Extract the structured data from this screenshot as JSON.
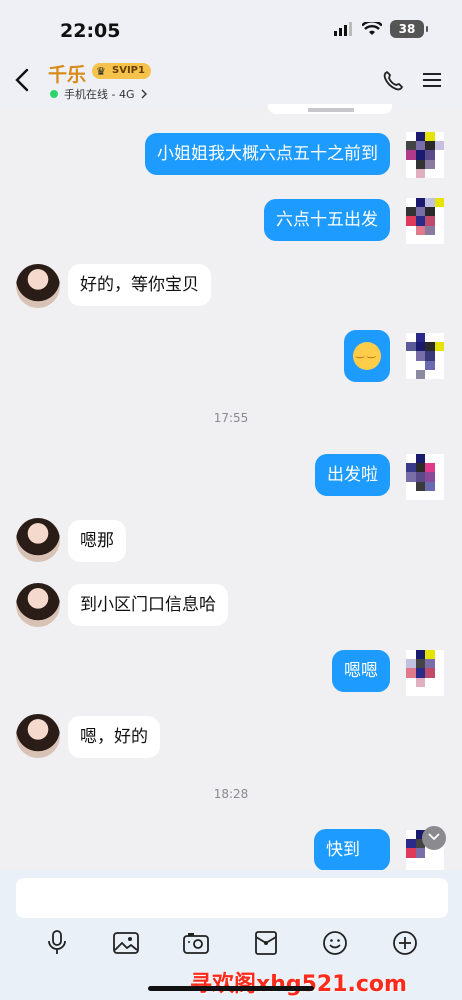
{
  "status_bar": {
    "time": "22:05",
    "battery": "38"
  },
  "header": {
    "contact_name": "千乐",
    "badge": "SVIP1",
    "status": "手机在线 - 4G",
    "back_icon": "chevron-left-icon",
    "call_icon": "phone-icon",
    "menu_icon": "menu-icon"
  },
  "messages": [
    {
      "side": "right",
      "text": "小姐姐我大概六点五十之前到"
    },
    {
      "side": "right",
      "text": "六点十五出发"
    },
    {
      "side": "left",
      "text": "好的，等你宝贝"
    },
    {
      "side": "right",
      "type": "emoji",
      "icon": "smile-emoji-icon"
    },
    {
      "type": "timestamp",
      "text": "17:55"
    },
    {
      "side": "right",
      "text": "出发啦"
    },
    {
      "side": "left",
      "text": "嗯那"
    },
    {
      "side": "left",
      "text": "到小区门口信息哈"
    },
    {
      "side": "right",
      "text": "嗯嗯"
    },
    {
      "side": "left",
      "text": "嗯，好的"
    },
    {
      "type": "timestamp",
      "text": "18:28"
    },
    {
      "side": "right",
      "text": "快到"
    }
  ],
  "input": {
    "placeholder": ""
  },
  "toolbar": {
    "icons": [
      "microphone-icon",
      "image-icon",
      "camera-icon",
      "red-packet-icon",
      "emoji-icon",
      "plus-icon"
    ]
  },
  "watermark": "寻欢阁xhg521.com",
  "colors": {
    "bubble_right": "#1e9bff",
    "bubble_left": "#ffffff",
    "name": "#d98a16",
    "online": "#2bd46b"
  }
}
